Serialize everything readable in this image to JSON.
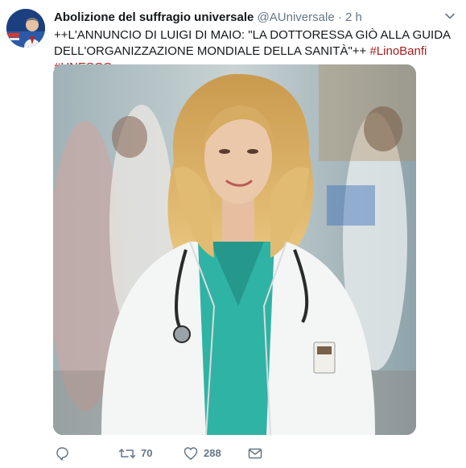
{
  "tweet": {
    "display_name": "Abolizione del suffragio universale",
    "handle": "@AUniversale",
    "separator": "·",
    "time": "2 h",
    "text_prefix": "++L'ANNUNCIO DI LUIGI DI MAIO: \"LA DOTTORESSA GIÒ ALLA GUIDA DELL'ORGANIZZAZIONE MONDIALE DELLA SANITÀ\"++",
    "hashtags": [
      "#LinoBanfi",
      "#UNESCO"
    ],
    "hashtag_color": "#a51d1d"
  },
  "actions": {
    "reply_icon": "reply-icon",
    "retweet_icon": "retweet-icon",
    "retweet_count": "70",
    "like_icon": "heart-icon",
    "like_count": "288",
    "dm_icon": "envelope-icon"
  },
  "colors": {
    "text": "#14171a",
    "secondary": "#657786",
    "scrub_top": "#0f2d6b",
    "scrub_scrub": "#2fb3a4"
  }
}
